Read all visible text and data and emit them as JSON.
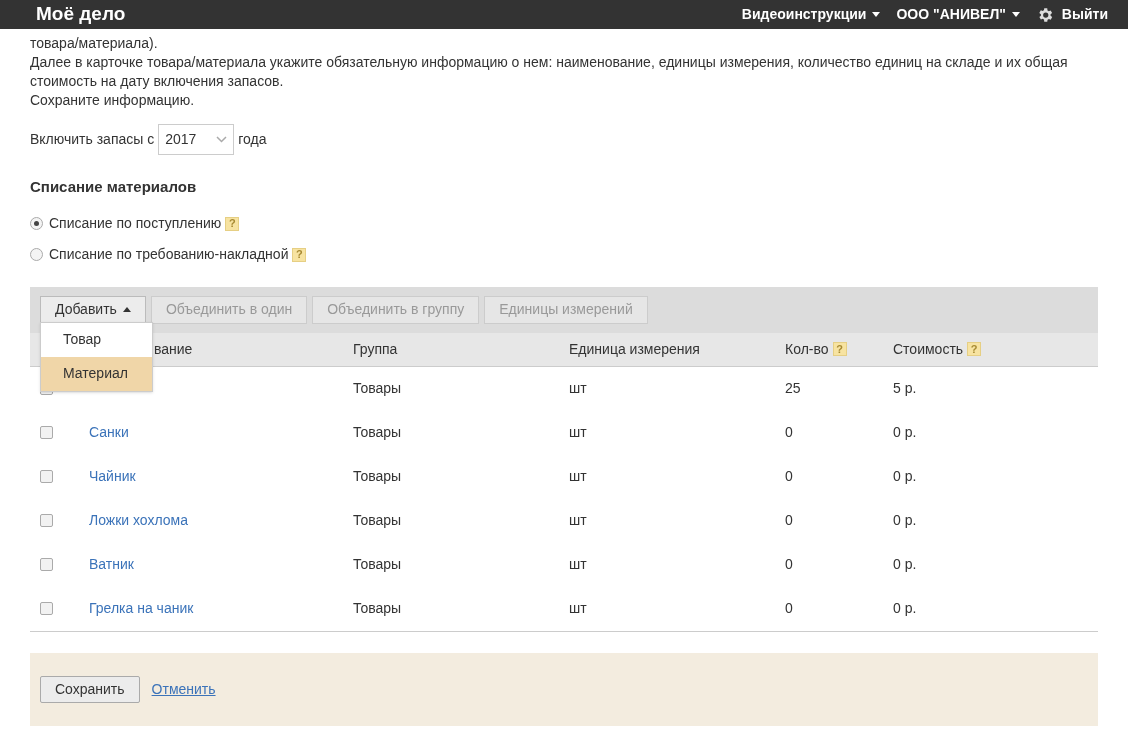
{
  "topbar": {
    "logo": "Моё дело",
    "menu": [
      {
        "label": "Видеоинструкции",
        "kind": "dropdown"
      },
      {
        "label": "ООО \"АНИВЕЛ\"",
        "kind": "dropdown"
      },
      {
        "label": "Выйти",
        "kind": "settings"
      }
    ]
  },
  "intro": [
    "товара/материала).",
    "Далее в карточке товара/материала укажите обязательную информацию о нем: наименование, единицы измерения, количество единиц на складе и их общая стоимость на дату включения запасов.",
    "Сохраните информацию."
  ],
  "year_row": {
    "before": "Включить запасы с",
    "value": "2017",
    "after": "года"
  },
  "section_title": "Списание материалов",
  "writeoff_options": [
    {
      "label": "Списание по поступлению",
      "selected": true,
      "help": "?"
    },
    {
      "label": "Списание по требованию-накладной",
      "selected": false,
      "help": "?"
    }
  ],
  "toolbar": {
    "add_button": "Добавить",
    "add_menu_expanded": true,
    "add_menu": [
      {
        "label": "Товар",
        "selected": false
      },
      {
        "label": "Материал",
        "selected": true
      }
    ],
    "buttons": [
      {
        "label": "Объединить в один",
        "disabled": true
      },
      {
        "label": "Объединить в группу",
        "disabled": true
      },
      {
        "label": "Единицы измерений",
        "disabled": true
      }
    ]
  },
  "table": {
    "columns": [
      {
        "label": "вание"
      },
      {
        "label": "Группа"
      },
      {
        "label": "Единица измерения"
      },
      {
        "label": "Кол-во",
        "help": "?"
      },
      {
        "label": "Стоимость",
        "help": "?"
      }
    ],
    "rows": [
      {
        "checked": false,
        "group": "Товары",
        "unit": "шт",
        "qty": "25",
        "cost": "5 р."
      },
      {
        "checked": false,
        "name": "Санки",
        "group": "Товары",
        "unit": "шт",
        "qty": "0",
        "cost": "0 р."
      },
      {
        "checked": false,
        "name": "Чайник",
        "group": "Товары",
        "unit": "шт",
        "qty": "0",
        "cost": "0 р."
      },
      {
        "checked": false,
        "name": "Ложки хохлома",
        "group": "Товары",
        "unit": "шт",
        "qty": "0",
        "cost": "0 р."
      },
      {
        "checked": false,
        "name": "Ватник",
        "group": "Товары",
        "unit": "шт",
        "qty": "0",
        "cost": "0 р."
      },
      {
        "checked": false,
        "name": "Грелка на чаник",
        "group": "Товары",
        "unit": "шт",
        "qty": "0",
        "cost": "0 р."
      }
    ]
  },
  "footer": {
    "save": "Сохранить",
    "cancel": "Отменить"
  }
}
